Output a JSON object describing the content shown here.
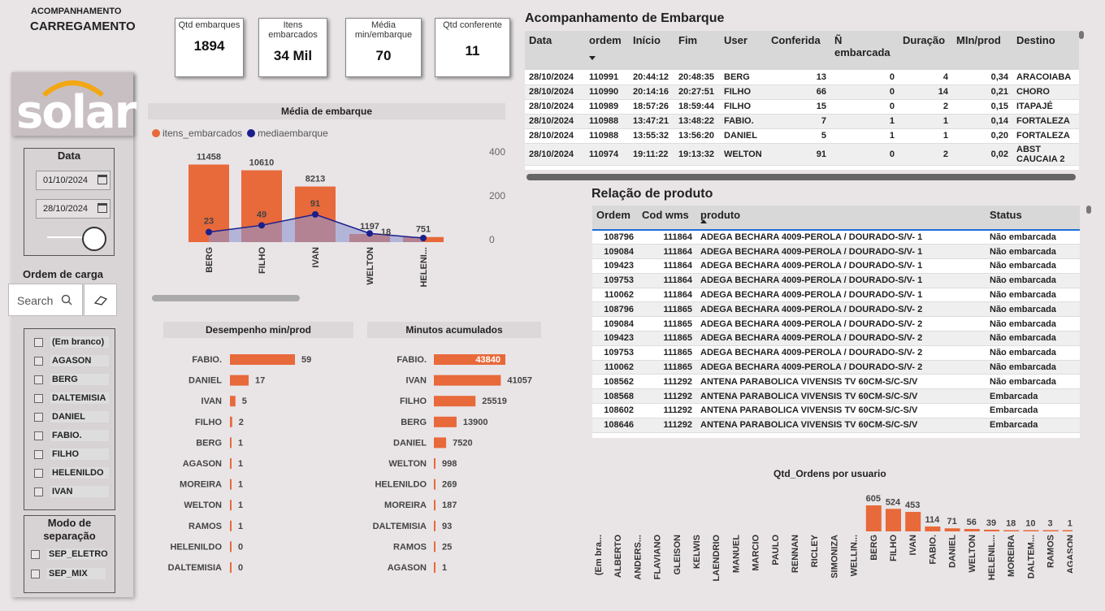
{
  "header": {
    "small": "ACOMPANHAMENTO",
    "big": "CARREGAMENTO"
  },
  "logo": "solar",
  "sidebar": {
    "date_label": "Data",
    "date_from": "01/10/2024",
    "date_to": "28/10/2024",
    "ordem_label": "Ordem de carga",
    "search_placeholder": "Search",
    "users": [
      "(Em branco)",
      "AGASON",
      "BERG",
      "DALTEMISIA",
      "DANIEL",
      "FABIO.",
      "FILHO",
      "HELENILDO",
      "IVAN"
    ],
    "modo_label": "Modo de separação",
    "modos": [
      "SEP_ELETRO",
      "SEP_MIX"
    ]
  },
  "kpis": [
    {
      "label": "Qtd embarques",
      "value": "1894"
    },
    {
      "label": "Itens embarcados",
      "value": "34 Mil"
    },
    {
      "label": "Média min/embarque",
      "value": "70"
    },
    {
      "label": "Qtd conferente",
      "value": "11"
    }
  ],
  "colors": {
    "orange": "#e8693a",
    "navy": "#1a1f8c",
    "area": "#8f95cf"
  },
  "chart_data": [
    {
      "type": "bar",
      "title": "Média de embarque",
      "legend": [
        "itens_embarcados",
        "mediaembarque"
      ],
      "categories": [
        "BERG",
        "FILHO",
        "IVAN",
        "WELTON",
        "HELENI..."
      ],
      "series": [
        {
          "name": "itens_embarcados",
          "values": [
            11458,
            10610,
            8213,
            1197,
            751
          ]
        },
        {
          "name": "mediaembarque",
          "values": [
            23,
            49,
            91,
            18,
            0
          ]
        }
      ],
      "y2_ticks": [
        "400",
        "200",
        "0"
      ]
    },
    {
      "type": "bar",
      "title": "Desempenho min/prod",
      "categories": [
        "FABIO.",
        "DANIEL",
        "IVAN",
        "FILHO",
        "BERG",
        "AGASON",
        "MOREIRA",
        "WELTON",
        "RAMOS",
        "HELENILDO",
        "DALTEMISIA"
      ],
      "values": [
        59,
        17,
        5,
        2,
        1,
        1,
        1,
        1,
        1,
        0,
        0
      ]
    },
    {
      "type": "bar",
      "title": "Minutos acumulados",
      "categories": [
        "FABIO.",
        "IVAN",
        "FILHO",
        "BERG",
        "DANIEL",
        "WELTON",
        "HELENILDO",
        "MOREIRA",
        "DALTEMISIA",
        "RAMOS",
        "AGASON"
      ],
      "values": [
        43840,
        41057,
        25519,
        13900,
        7520,
        998,
        269,
        187,
        93,
        25,
        1
      ]
    },
    {
      "type": "bar",
      "title": "Qtd_Ordens por usuario",
      "categories": [
        "(Em bra...",
        "ALBERTO",
        "ANDERS...",
        "FLAVIANO",
        "GLEISON",
        "KELWIS",
        "LAENDRIO",
        "MANUEL",
        "MARCIO",
        "PAULO",
        "RENNAN",
        "RICLEY",
        "SIMONIZA",
        "WELLIN...",
        "BERG",
        "FILHO",
        "IVAN",
        "FABIO.",
        "DANIEL",
        "WELTON",
        "HELENIL...",
        "MOREIRA",
        "DALTEM...",
        "RAMOS",
        "AGASON"
      ],
      "values": [
        null,
        null,
        null,
        null,
        null,
        null,
        null,
        null,
        null,
        null,
        null,
        null,
        null,
        null,
        605,
        524,
        453,
        114,
        71,
        56,
        39,
        18,
        10,
        3,
        1
      ]
    }
  ],
  "embarque": {
    "title": "Acompanhamento de Embarque",
    "headers": [
      "Data",
      "ordem",
      "Início",
      "Fim",
      "User",
      "Conferida",
      "Ñ embarcada",
      "Duração",
      "MIn/prod",
      "Destino"
    ],
    "rows": [
      [
        "28/10/2024",
        "110991",
        "20:44:12",
        "20:48:35",
        "BERG",
        "13",
        "0",
        "4",
        "0,34",
        "ARACOIABA"
      ],
      [
        "28/10/2024",
        "110990",
        "20:14:16",
        "20:27:51",
        "FILHO",
        "66",
        "0",
        "14",
        "0,21",
        "CHORO"
      ],
      [
        "28/10/2024",
        "110989",
        "18:57:26",
        "18:59:44",
        "FILHO",
        "15",
        "0",
        "2",
        "0,15",
        "ITAPAJÉ"
      ],
      [
        "28/10/2024",
        "110988",
        "13:47:21",
        "13:48:22",
        "FABIO.",
        "7",
        "1",
        "1",
        "0,14",
        "FORTALEZA"
      ],
      [
        "28/10/2024",
        "110988",
        "13:55:32",
        "13:56:20",
        "DANIEL",
        "5",
        "1",
        "1",
        "0,20",
        "FORTALEZA"
      ],
      [
        "28/10/2024",
        "110974",
        "19:11:22",
        "19:13:32",
        "WELTON",
        "91",
        "0",
        "2",
        "0,02",
        "ABST CAUCAIA 2"
      ]
    ]
  },
  "produto": {
    "title": "Relação de produto",
    "headers": [
      "Ordem",
      "Cod wms",
      "produto",
      "Status"
    ],
    "rows": [
      [
        "108796",
        "111864",
        "ADEGA BECHARA 4009-PEROLA / DOURADO-S/V- 1",
        "Não embarcada"
      ],
      [
        "109084",
        "111864",
        "ADEGA BECHARA 4009-PEROLA / DOURADO-S/V- 1",
        "Não embarcada"
      ],
      [
        "109423",
        "111864",
        "ADEGA BECHARA 4009-PEROLA / DOURADO-S/V- 1",
        "Não embarcada"
      ],
      [
        "109753",
        "111864",
        "ADEGA BECHARA 4009-PEROLA / DOURADO-S/V- 1",
        "Não embarcada"
      ],
      [
        "110062",
        "111864",
        "ADEGA BECHARA 4009-PEROLA / DOURADO-S/V- 1",
        "Não embarcada"
      ],
      [
        "108796",
        "111865",
        "ADEGA BECHARA 4009-PEROLA / DOURADO-S/V- 2",
        "Não embarcada"
      ],
      [
        "109084",
        "111865",
        "ADEGA BECHARA 4009-PEROLA / DOURADO-S/V- 2",
        "Não embarcada"
      ],
      [
        "109423",
        "111865",
        "ADEGA BECHARA 4009-PEROLA / DOURADO-S/V- 2",
        "Não embarcada"
      ],
      [
        "109753",
        "111865",
        "ADEGA BECHARA 4009-PEROLA / DOURADO-S/V- 2",
        "Não embarcada"
      ],
      [
        "110062",
        "111865",
        "ADEGA BECHARA 4009-PEROLA / DOURADO-S/V- 2",
        "Não embarcada"
      ],
      [
        "108562",
        "111292",
        "ANTENA PARABOLICA VIVENSIS TV 60CM-S/C-S/V",
        "Não embarcada"
      ],
      [
        "108568",
        "111292",
        "ANTENA PARABOLICA VIVENSIS TV 60CM-S/C-S/V",
        "Embarcada"
      ],
      [
        "108602",
        "111292",
        "ANTENA PARABOLICA VIVENSIS TV 60CM-S/C-S/V",
        "Embarcada"
      ],
      [
        "108646",
        "111292",
        "ANTENA PARABOLICA VIVENSIS TV 60CM-S/C-S/V",
        "Embarcada"
      ]
    ]
  }
}
